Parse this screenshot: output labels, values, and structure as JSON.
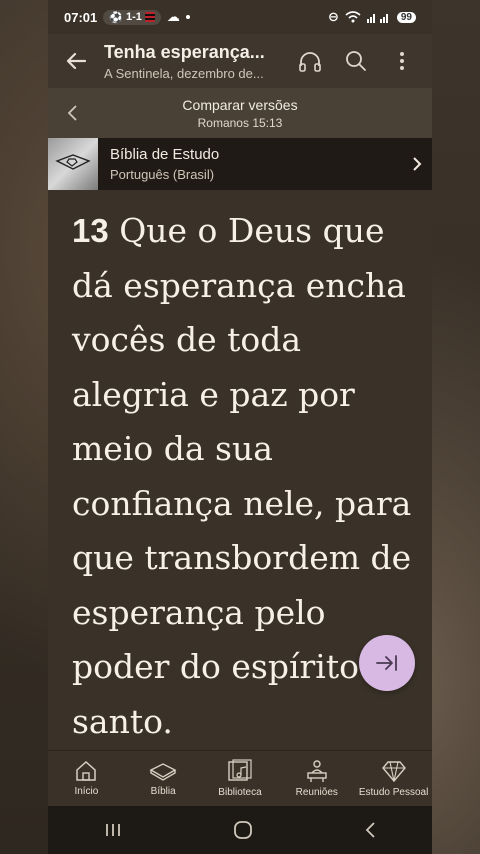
{
  "status": {
    "time": "07:01",
    "score": "1-1",
    "battery": "99"
  },
  "header": {
    "title": "Tenha esperança...",
    "subtitle": "A Sentinela, dezembro de..."
  },
  "compare": {
    "title": "Comparar versões",
    "reference": "Romanos 15:13"
  },
  "bible": {
    "name": "Bíblia de Estudo",
    "language": "Português (Brasil)"
  },
  "verse": {
    "number": "13",
    "text": "Que o Deus que dá esperança encha vocês de toda alegria e paz por meio da sua confiança nele, para que transbordem de esperança pelo poder do espírito santo."
  },
  "nav": {
    "items": [
      {
        "label": "Início",
        "icon": "home-icon"
      },
      {
        "label": "Bíblia",
        "icon": "bible-icon"
      },
      {
        "label": "Biblioteca",
        "icon": "library-icon"
      },
      {
        "label": "Reuniões",
        "icon": "meetings-icon"
      },
      {
        "label": "Estudo Pessoal",
        "icon": "diamond-icon"
      }
    ]
  },
  "colors": {
    "background": "#3a3228",
    "fab": "#d7b9e4",
    "text": "#f6f0e6"
  }
}
